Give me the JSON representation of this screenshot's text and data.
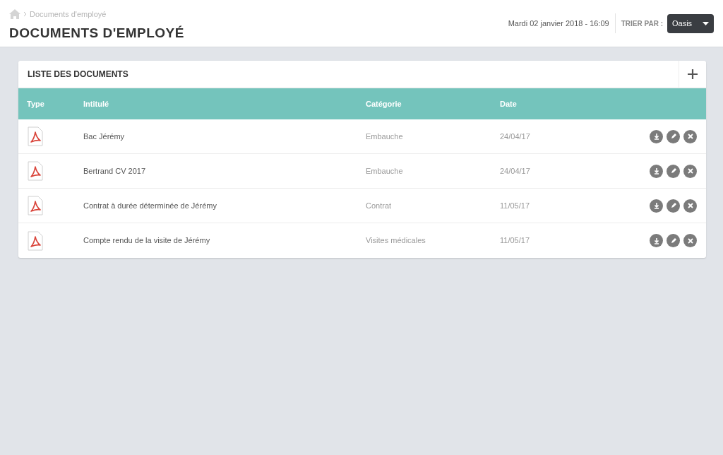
{
  "breadcrumb": {
    "items": [
      "Documents d'employé"
    ]
  },
  "page_title": "DOCUMENTS D'EMPLOYÉ",
  "datetime": "Mardi 02 janvier 2018 - 16:09",
  "sort": {
    "label": "TRIER PAR :",
    "value": "Oasis"
  },
  "panel": {
    "title": "LISTE DES DOCUMENTS"
  },
  "table": {
    "columns": [
      "Type",
      "Intitulé",
      "Catégorie",
      "Date"
    ],
    "rows": [
      {
        "kind": "pdf",
        "title": "Bac Jérémy",
        "category": "Embauche",
        "date": "24/04/17"
      },
      {
        "kind": "pdf",
        "title": "Bertrand CV 2017",
        "category": "Embauche",
        "date": "24/04/17"
      },
      {
        "kind": "pdf",
        "title": "Contrat à durée déterminée de Jérémy",
        "category": "Contrat",
        "date": "11/05/17"
      },
      {
        "kind": "pdf",
        "title": "Compte rendu de la visite de Jérémy",
        "category": "Visites médicales",
        "date": "11/05/17"
      }
    ]
  }
}
